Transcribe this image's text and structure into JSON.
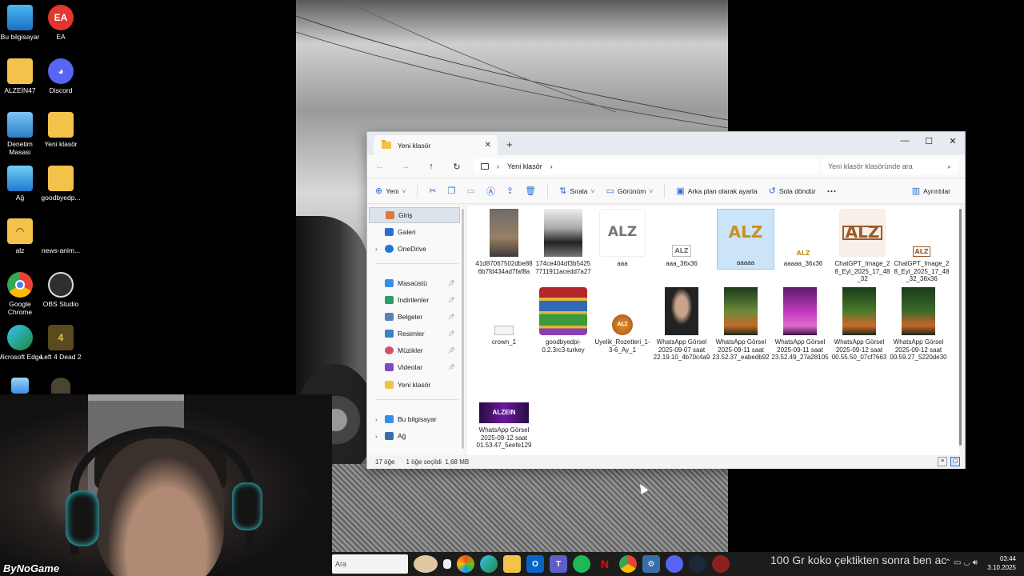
{
  "desktop": {
    "icons": [
      {
        "label": "Bu bilgisayar",
        "icon": "computer-icon"
      },
      {
        "label": "EA",
        "icon": "ea-icon"
      },
      {
        "label": "ALZEİN47",
        "icon": "folder-icon"
      },
      {
        "label": "Discord",
        "icon": "discord-icon"
      },
      {
        "label": "Denetim Masası",
        "icon": "control-panel-icon"
      },
      {
        "label": "Yeni klasör",
        "icon": "folder-icon"
      },
      {
        "label": "Ağ",
        "icon": "network-icon"
      },
      {
        "label": "goodbyedp...",
        "icon": "folder-icon"
      },
      {
        "label": "alz",
        "icon": "folder-icon"
      },
      {
        "label": "news-anim...",
        "icon": "file-icon"
      },
      {
        "label": "Google Chrome",
        "icon": "chrome-icon"
      },
      {
        "label": "OBS Studio",
        "icon": "obs-icon"
      },
      {
        "label": "Microsoft Edge",
        "icon": "edge-icon"
      },
      {
        "label": "Left 4 Dead 2",
        "icon": "game-icon"
      }
    ]
  },
  "webcam": {
    "brand": "ByNoGame"
  },
  "explorer": {
    "tab_title": "Yeni klasör",
    "tab_close": "✕",
    "new_tab": "+",
    "controls": {
      "minimize": "—",
      "maximize": "☐",
      "close": "✕"
    },
    "address": {
      "crumb": "Yeni klasör",
      "sep": "›"
    },
    "search_placeholder": "Yeni klasör klasöründe ara",
    "toolbar": {
      "new": "Yeni",
      "sort": "Sırala",
      "view": "Görünüm",
      "set_background": "Arka plan olarak ayarla",
      "rotate_left": "Sola döndür",
      "more": "···",
      "details": "Ayrıntılar"
    },
    "nav": [
      {
        "label": "Giriş",
        "icon": "home-icon",
        "color": "#e07a3a",
        "selected": true
      },
      {
        "label": "Galeri",
        "icon": "gallery-icon",
        "color": "#2b6fd6"
      },
      {
        "label": "OneDrive",
        "icon": "onedrive-icon",
        "color": "#1f78d1",
        "chevron": true
      },
      {
        "label": "Masaüstü",
        "icon": "desktop-icon",
        "color": "#3a8ee6",
        "pinned": true
      },
      {
        "label": "İndirilenler",
        "icon": "download-icon",
        "color": "#2e9b6a",
        "pinned": true
      },
      {
        "label": "Belgeler",
        "icon": "documents-icon",
        "color": "#5a7fb8",
        "pinned": true
      },
      {
        "label": "Resimler",
        "icon": "pictures-icon",
        "color": "#3b82c4",
        "pinned": true
      },
      {
        "label": "Müzikler",
        "icon": "music-icon",
        "color": "#d0526a",
        "pinned": true
      },
      {
        "label": "Videolar",
        "icon": "videos-icon",
        "color": "#7a4bc4",
        "pinned": true
      },
      {
        "label": "Yeni klasör",
        "icon": "folder-icon",
        "color": "#f3c24a"
      },
      {
        "label": "Bu bilgisayar",
        "icon": "computer-icon",
        "color": "#3a8ee6",
        "chevron": true
      },
      {
        "label": "Ağ",
        "icon": "network-icon",
        "color": "#3a6ea8",
        "chevron": true
      }
    ],
    "files": [
      {
        "name": "41d87067502dbe886b7fd434ad7faf8a"
      },
      {
        "name": "174ce404df3b54257711911acedd7a27"
      },
      {
        "name": "aaa",
        "logo": "ALZ"
      },
      {
        "name": "aaa_36x36",
        "logo": "ALZ"
      },
      {
        "name": "aaaaa",
        "logo": "ALZ",
        "selected": true
      },
      {
        "name": "aaaaa_36x36",
        "logo": "ALZ"
      },
      {
        "name": "ChatGPT_Image_28_Eyl_2025_17_48_32",
        "logo": "ALZ"
      },
      {
        "name": "ChatGPT_Image_28_Eyl_2025_17_48_32_36x36",
        "logo": "ALZ"
      },
      {
        "name": "crown_1"
      },
      {
        "name": "goodbyedpi-0.2.3rc3-turkey"
      },
      {
        "name": "Uyelik_Rozetleri_1-3-6_Ay_1",
        "logo": "ALZ"
      },
      {
        "name": "WhatsApp Görsel 2025-09-07 saat 22.19.10_4b70c4a9"
      },
      {
        "name": "WhatsApp Görsel 2025-09-11 saat 23.52.37_eabedb92"
      },
      {
        "name": "WhatsApp Görsel 2025-09-11 saat 23.52.49_27a28105"
      },
      {
        "name": "WhatsApp Görsel 2025-09-12 saat 00.55.50_07cf7663"
      },
      {
        "name": "WhatsApp Görsel 2025-09-12 saat 00.59.27_5220de30"
      },
      {
        "name": "WhatsApp Görsel 2025-09-12 saat 01.53.47_5eefe129",
        "banner": "ALZEIN"
      }
    ],
    "status": {
      "count": "17 öğe",
      "selected": "1 öğe seçildi",
      "size": "1,68 MB"
    }
  },
  "taskbar": {
    "search_placeholder": "Ara",
    "marquee": "100 Gr koko çektikten sonra ben ac",
    "time": "03:44",
    "date": "3.10.2025"
  }
}
